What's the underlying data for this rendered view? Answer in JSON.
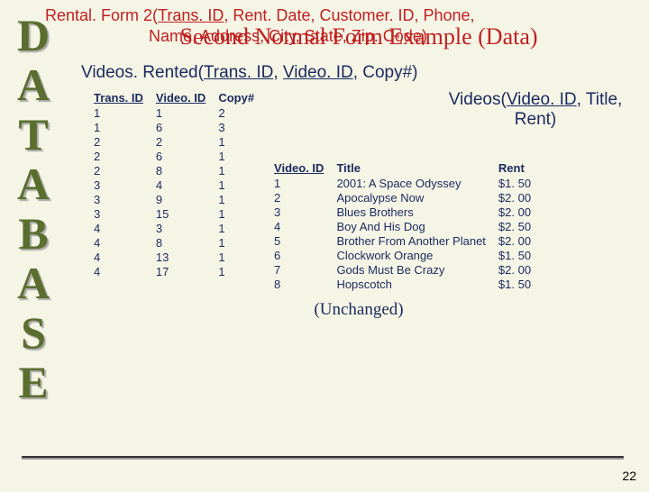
{
  "sidebar": {
    "letters": [
      "D",
      "A",
      "T",
      "A",
      "B",
      "A",
      "S",
      "E"
    ]
  },
  "title": "Second Normal Form Example (Data)",
  "schema1": {
    "prefix": "Videos. Rented(",
    "underlined": "Trans. ID",
    "mid": ", ",
    "underlined2": "Video. ID",
    "suffix": ", Copy#)"
  },
  "schema2": {
    "prefix": "Videos(",
    "underlined": "Video. ID",
    "suffix": ", Title, Rent)"
  },
  "table1": {
    "headers": [
      "Trans. ID",
      "Video. ID",
      "Copy#"
    ],
    "rows": [
      [
        "1",
        "1",
        "2"
      ],
      [
        "1",
        "6",
        "3"
      ],
      [
        "2",
        "2",
        "1"
      ],
      [
        "2",
        "6",
        "1"
      ],
      [
        "2",
        "8",
        "1"
      ],
      [
        "3",
        "4",
        "1"
      ],
      [
        "3",
        "9",
        "1"
      ],
      [
        "3",
        "15",
        "1"
      ],
      [
        "4",
        "3",
        "1"
      ],
      [
        "4",
        "8",
        "1"
      ],
      [
        "4",
        "13",
        "1"
      ],
      [
        "4",
        "17",
        "1"
      ]
    ]
  },
  "table2": {
    "headers": [
      "Video. ID",
      "Title",
      "Rent"
    ],
    "rows": [
      [
        "1",
        "2001:  A Space Odyssey",
        "$1. 50"
      ],
      [
        "2",
        "Apocalypse Now",
        "$2. 00"
      ],
      [
        "3",
        "Blues Brothers",
        "$2. 00"
      ],
      [
        "4",
        "Boy And His Dog",
        "$2. 50"
      ],
      [
        "5",
        "Brother From Another Planet",
        "$2. 00"
      ],
      [
        "6",
        "Clockwork Orange",
        "$1. 50"
      ],
      [
        "7",
        "Gods Must Be Crazy",
        "$2. 00"
      ],
      [
        "8",
        "Hopscotch",
        "$1. 50"
      ]
    ]
  },
  "unchanged": "(Unchanged)",
  "rental": {
    "line1_prefix": "Rental. Form 2(",
    "line1_underlined": "Trans. ID",
    "line1_suffix": ", Rent. Date, Customer. ID, Phone,",
    "line2": "Name, Address, City, State, Zip. Code)"
  },
  "page": "22"
}
